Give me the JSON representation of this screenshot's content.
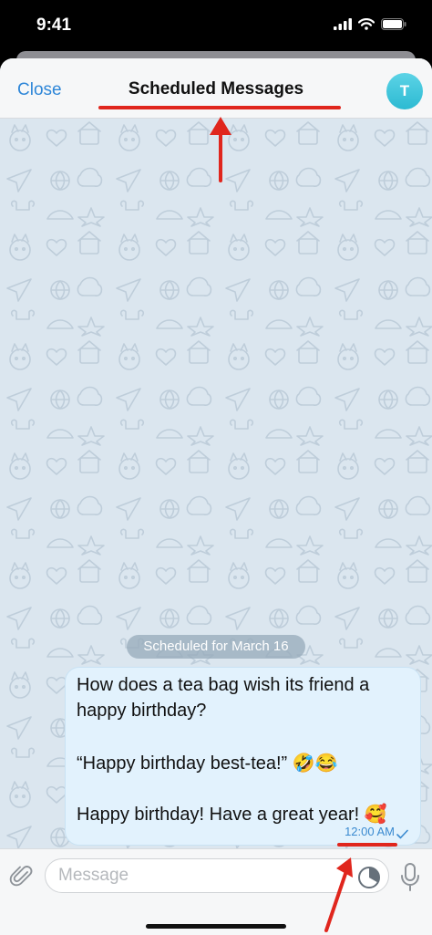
{
  "status_bar": {
    "time": "9:41"
  },
  "header": {
    "close_label": "Close",
    "title": "Scheduled Messages",
    "avatar_initial": "T"
  },
  "chat": {
    "date_label": "Scheduled for March 16",
    "message": {
      "lines": [
        "How does a tea bag wish its friend a",
        "happy birthday?",
        "“Happy birthday best-tea!” 🤣😂",
        "Happy birthday! Have a great year! 🥰"
      ],
      "time": "12:00 AM",
      "status": "sent"
    }
  },
  "composer": {
    "placeholder": "Message"
  },
  "colors": {
    "accent": "#2f87d8",
    "chat_background": "#dbe6ef",
    "bubble": "#e2f2fd",
    "annotation": "#e0261d"
  },
  "icons": [
    "cellular-icon",
    "wifi-icon",
    "battery-icon",
    "paperclip-icon",
    "schedule-clock-icon",
    "microphone-icon",
    "checkmark-icon",
    "arrow-up-icon"
  ]
}
